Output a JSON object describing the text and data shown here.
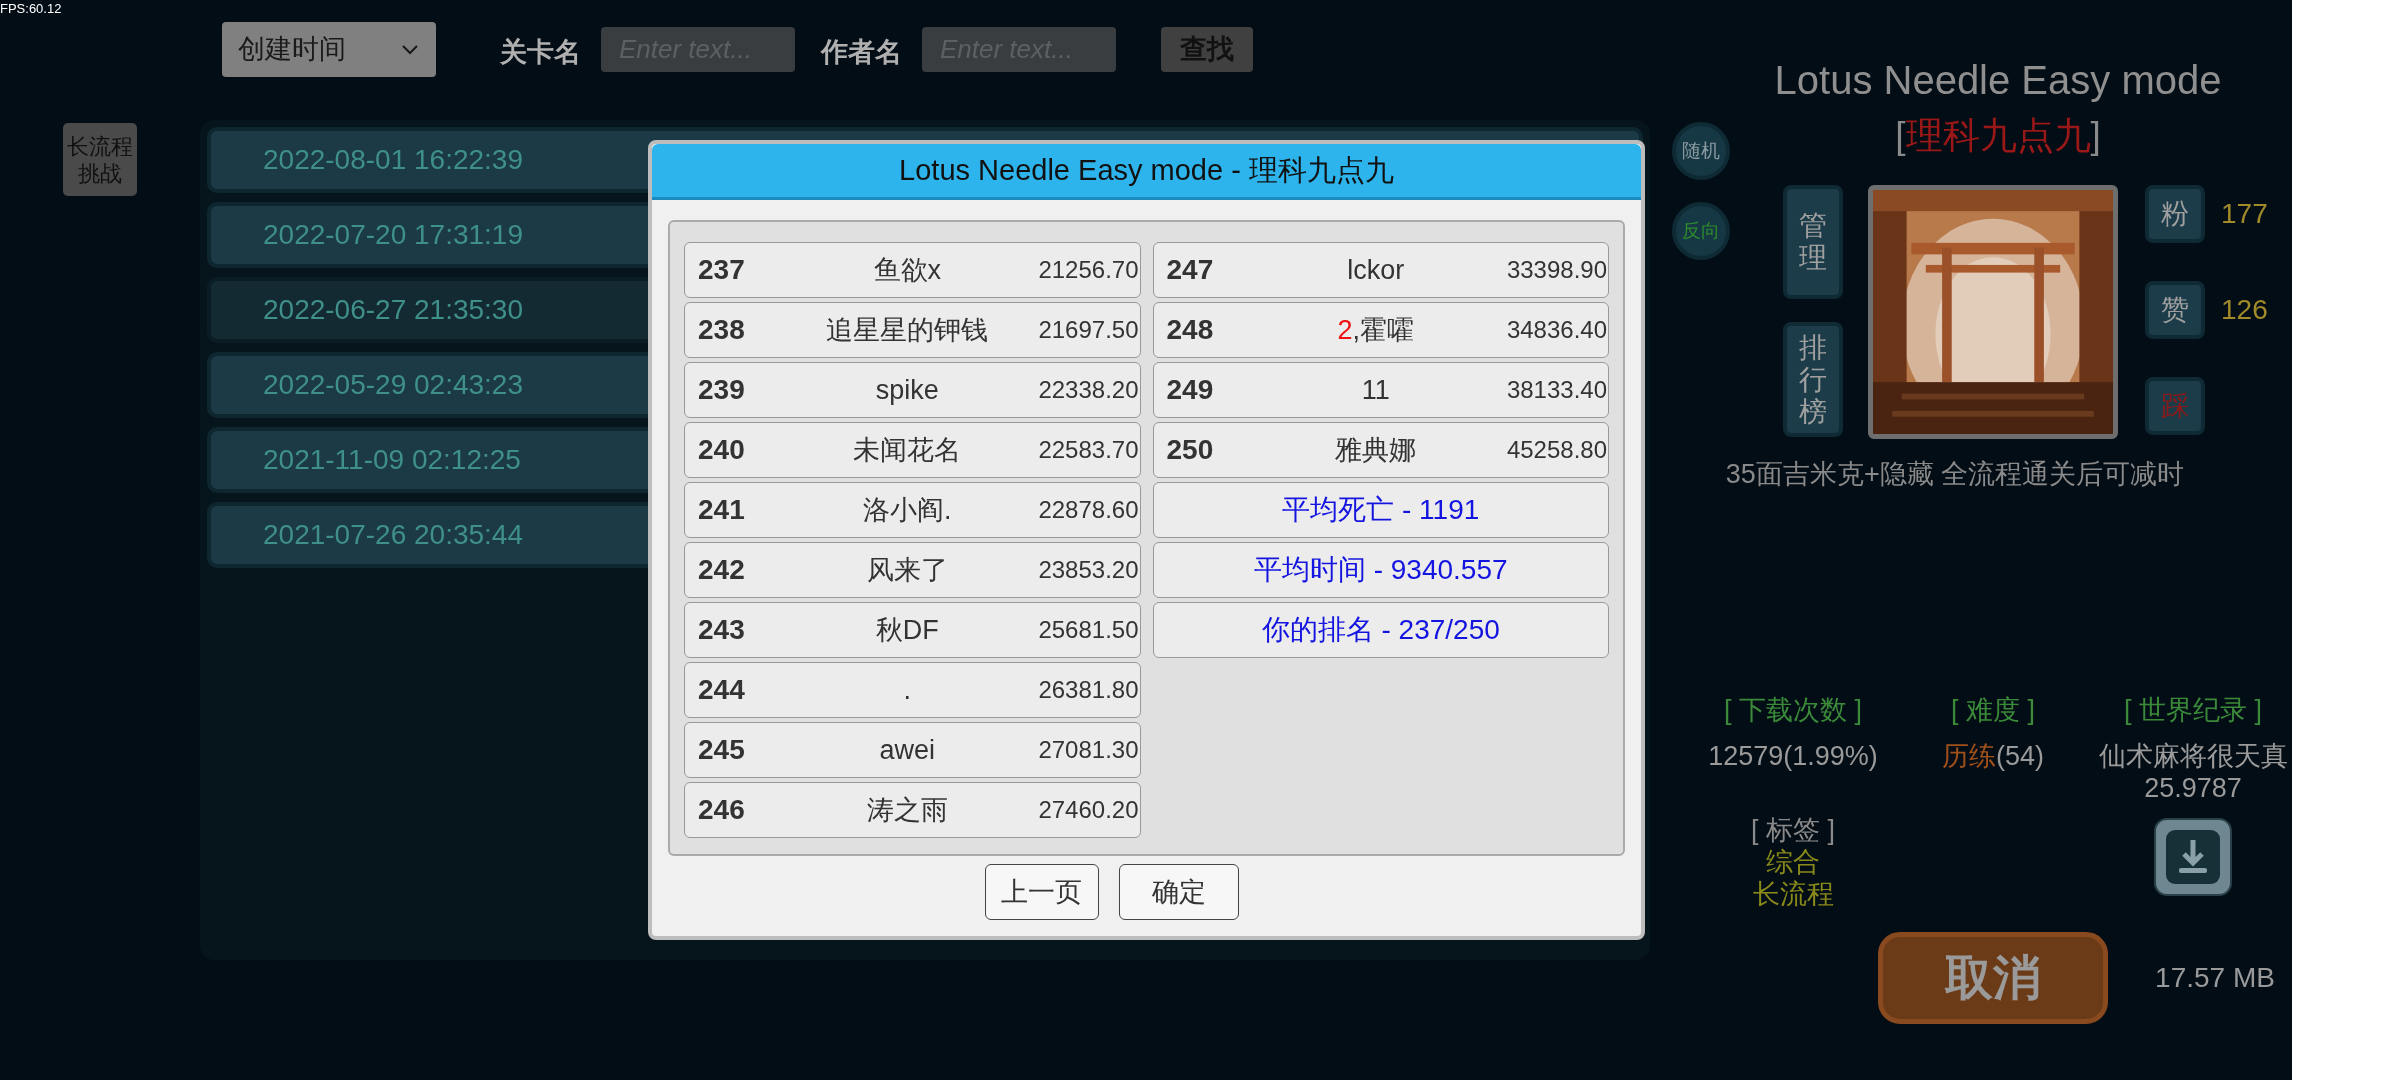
{
  "fps": "FPS:60.12",
  "toolbar": {
    "sort": "创建时间",
    "level_label": "关卡名",
    "level_placeholder": "Enter text...",
    "author_label": "作者名",
    "author_placeholder": "Enter text...",
    "search": "查找"
  },
  "side_button": "长流程挑战",
  "list": [
    {
      "date": "2022-08-01 16:22:39",
      "selected": false
    },
    {
      "date": "2022-07-20 17:31:19",
      "selected": false
    },
    {
      "date": "2022-06-27 21:35:30",
      "selected": true
    },
    {
      "date": "2022-05-29 02:43:23",
      "selected": false
    },
    {
      "date": "2021-11-09 02:12:25",
      "selected": false
    },
    {
      "date": "2021-07-26 20:35:44",
      "selected": false
    }
  ],
  "toggles": [
    {
      "label": "随机",
      "on": false
    },
    {
      "label": "反向",
      "on": true
    }
  ],
  "dialog": {
    "title": "Lotus Needle Easy mode - 理科九点九",
    "columns": [
      {
        "entries": [
          {
            "rank": "237",
            "name": "鱼欲x",
            "time": "21256.70"
          },
          {
            "rank": "238",
            "name": "追星星的钾钱",
            "time": "21697.50"
          },
          {
            "rank": "239",
            "name": "spike",
            "time": "22338.20"
          },
          {
            "rank": "240",
            "name": "未闻花名",
            "time": "22583.70"
          },
          {
            "rank": "241",
            "name": "洛小阎.",
            "time": "22878.60"
          },
          {
            "rank": "242",
            "name": "风来了",
            "time": "23853.20"
          },
          {
            "rank": "243",
            "name": "秋DF",
            "time": "25681.50"
          },
          {
            "rank": "244",
            "name": ".",
            "time": "26381.80"
          },
          {
            "rank": "245",
            "name": "awei",
            "time": "27081.30"
          },
          {
            "rank": "246",
            "name": "涛之雨",
            "time": "27460.20"
          }
        ]
      },
      {
        "entries": [
          {
            "rank": "247",
            "name": "lckor",
            "time": "33398.90"
          },
          {
            "rank": "248",
            "name_prefix": "2",
            "name": ",霍嚯",
            "time": "34836.40"
          },
          {
            "rank": "249",
            "name": "11",
            "time": "38133.40"
          },
          {
            "rank": "250",
            "name": "雅典娜",
            "time": "45258.80"
          }
        ],
        "summaries": [
          "平均死亡 - 1191",
          "平均时间 - 9340.557",
          "你的排名 - 237/250"
        ]
      }
    ],
    "buttons": [
      "上一页",
      "确定"
    ]
  },
  "detail": {
    "title": "Lotus Needle Easy mode",
    "author": {
      "open": "[",
      "name": "理科九点九",
      "close": "]"
    },
    "side_buttons": [
      "管理",
      "排行榜"
    ],
    "reactions": [
      {
        "label": "粉",
        "count": "177",
        "kind": "fan"
      },
      {
        "label": "赞",
        "count": "126",
        "kind": "like"
      },
      {
        "label": "踩",
        "kind": "dislike"
      }
    ],
    "description": "35面吉米克+隐藏 全流程通关后可减时",
    "downloads": {
      "heading": "[ 下载次数 ]",
      "value": "12579(1.99%)"
    },
    "difficulty": {
      "heading": "[ 难度 ]",
      "name": "历练",
      "count": "(54)"
    },
    "world_record": {
      "heading": "[ 世界纪录 ]",
      "holder": "仙术麻将很天真",
      "time": "25.9787"
    },
    "tags": {
      "heading": "[ 标签 ]",
      "items": [
        "综合",
        "长流程"
      ]
    },
    "cancel": "取消",
    "size": "17.57 MB"
  }
}
